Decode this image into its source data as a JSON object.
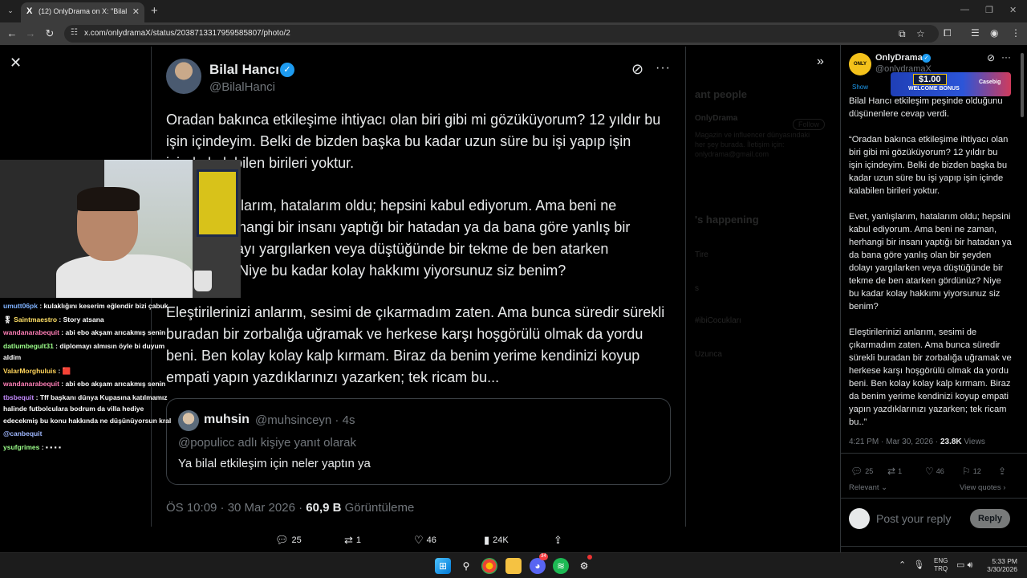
{
  "browser": {
    "tab_title": "(12) OnlyDrama on X: \"Bilal Hanc",
    "tab_favicon": "X",
    "new_tab": "+",
    "url": "x.com/onlydramaX/status/2038713317959585807/photo/2"
  },
  "photo": {
    "name": "Bilal Hancı",
    "handle": "@BilalHanci",
    "paragraphs": [
      "Oradan bakınca etkileşime ihtiyacı olan biri gibi mi gözüküyorum? 12 yıldır bu işin içindeyim. Belki de bizden başka bu kadar uzun süre bu işi yapıp işin içinde kalabilen birileri yoktur.",
      "Evet, yanlışlarım, hatalarım oldu; hepsini kabul ediyorum. Ama beni ne zaman, herhangi bir insanı yaptığı bir hatadan ya da bana göre yanlış bir şeyden dolayı yargılarken veya düştüğünde bir tekme de ben atarken gördünüz? Niye bu kadar kolay hakkımı yiyorsunuz siz benim?",
      "Eleştirilerinizi anlarım, sesimi de çıkarmadım zaten. Ama bunca süredir sürekli buradan bir zorbalığa uğramak ve herkese karşı hoşgörülü olmak da yordu beni. Ben kolay kolay kalp kırmam. Biraz da benim yerime kendinizi koyup empati yapın yazdıklarınızı yazarken; tek ricam bu..."
    ],
    "quote": {
      "name": "muhsin",
      "meta": "@muhsinceyn · 4s",
      "replying": "@populicc adlı kişiye yanıt olarak",
      "text": "Ya bilal etkileşim için neler yaptın ya"
    },
    "stats_time": "ÖS 10:09 · 30 Mar 2026 · ",
    "stats_views": "60,9 B",
    "stats_views_label": " Görüntüleme"
  },
  "background_page": {
    "heading1": "ant people",
    "account": "OnlyDrama",
    "follow": "Follow",
    "bio": "Magazin ve influencer dünyasındaki her şey burada. İletişim için: onlydrama@gmail.com",
    "heading2": "'s happening",
    "trends": [
      "Tire",
      "s",
      "#ibiCocukları",
      "Uzunca"
    ]
  },
  "chat": [
    {
      "user": "umutt06pk",
      "color": "#7fb2ff",
      "text": "kulaklığını keserim eğlendir bizi çabuk"
    },
    {
      "user": "Saintmaestro",
      "color": "#ffe066",
      "badge": "🎖",
      "text": "Story atsana"
    },
    {
      "user": "wandanarabequit",
      "color": "#ff7eb6",
      "text": "abi ebo akşam arıcakmış senin"
    },
    {
      "user": "datlumbegult31",
      "color": "#9cff8a",
      "text": "diplomayı almısın öyle bi duyum aldim"
    },
    {
      "user": "ValarMorghuluis",
      "color": "#ffd45a",
      "text": "🟥"
    },
    {
      "user": "wandanarabequit",
      "color": "#ff7eb6",
      "text": "abi ebo akşam arıcakmış senin"
    },
    {
      "user": "tbsbequit",
      "color": "#c58bff",
      "text": "Tff başkanı dünya Kupasına katılmamız halinde futbolculara bodrum da villa hediye edecekmiş bu konu hakkında ne düşünüyorsun kral"
    },
    {
      "user": "@canbequit",
      "color": "#9fb7ff",
      "text": ""
    },
    {
      "user": "ysufgrimes",
      "color": "#9cff8a",
      "text": "▪ ▪ ▪ ▪"
    }
  ],
  "right": {
    "name": "OnlyDrama",
    "handle": "@onlydramaX",
    "avatar_text": "ONLY DRAMA",
    "ad": {
      "amount": "$1.00",
      "label": "WELCOME BONUS",
      "brand": "Casebig",
      "show": "Show"
    },
    "paragraphs": [
      "Bilal Hancı etkileşim peşinde olduğunu düşünenlere cevap verdi.",
      "“Oradan bakınca etkileşime ihtiyacı olan biri gibi mi gözüküyorum? 12 yıldır bu işin içindeyim. Belki de bizden başka bu kadar uzun süre bu işi yapıp işin içinde kalabilen birileri yoktur.",
      "Evet, yanlışlarım, hatalarım oldu; hepsini kabul ediyorum. Ama beni ne zaman, herhangi bir insanı yaptığı bir hatadan ya da bana göre yanlış olan bir şeyden dolayı yargılarken veya düştüğünde bir tekme de ben atarken gördünüz? Niye bu kadar kolay hakkımı yiyorsunuz siz benim?",
      "Eleştirilerinizi anlarım, sesimi de çıkarmadım zaten. Ama bunca süredir sürekli buradan bir zorbalığa uğramak ve herkese karşı hoşgörülü olmak da yordu beni. Ben kolay kolay kalp kırmam. Biraz da benim yerime kendinizi koyup empati yapın yazdıklarınızı yazarken; tek ricam bu..”"
    ],
    "meta_time": "4:21 PM · Mar 30, 2026 · ",
    "meta_views": "23.8K",
    "meta_views_label": " Views",
    "replies": "25",
    "reposts": "1",
    "likes": "46",
    "bookmarks": "12",
    "relevant": "Relevant",
    "view_quotes": "View quotes",
    "reply_placeholder": "Post your reply",
    "reply_button": "Reply"
  },
  "actionbar": {
    "replies": "25",
    "reposts": "1",
    "likes": "46",
    "views": "24K"
  },
  "taskbar": {
    "lang_top": "ENG",
    "lang_bottom": "TRQ",
    "time": "5:33 PM",
    "date": "3/30/2026",
    "discord_badge": "34"
  }
}
